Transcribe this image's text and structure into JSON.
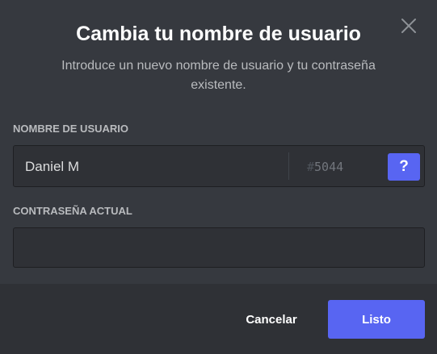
{
  "dialog": {
    "title": "Cambia tu nombre de usuario",
    "subtitle": "Introduce un nuevo nombre de usuario y tu contraseña existente.",
    "close_icon": "close-icon"
  },
  "username": {
    "label": "NOMBRE DE USUARIO",
    "value": "Daniel M",
    "discriminator_hash": "#",
    "discriminator": "5044",
    "help_label": "?"
  },
  "password": {
    "label": "CONTRASEÑA ACTUAL",
    "value": "",
    "placeholder": ""
  },
  "footer": {
    "cancel_label": "Cancelar",
    "done_label": "Listo"
  },
  "colors": {
    "background": "#36393f",
    "footer": "#2f3136",
    "accent": "#5865f2"
  }
}
